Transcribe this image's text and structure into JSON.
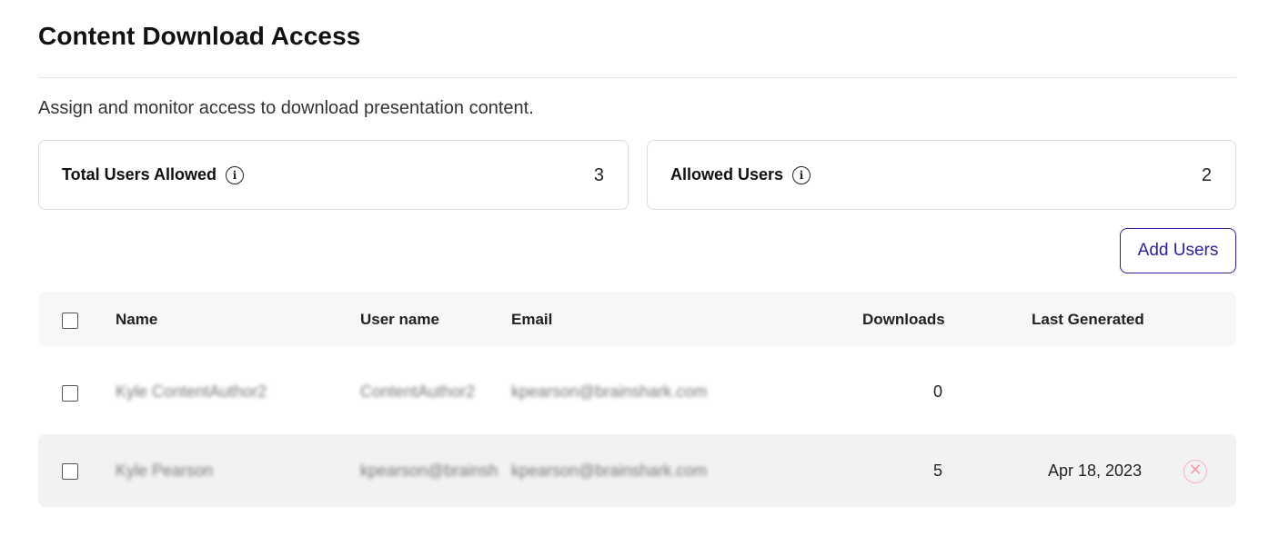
{
  "page": {
    "title": "Content Download Access",
    "description": "Assign and monitor access to download presentation content."
  },
  "stats": {
    "total_users_allowed": {
      "label": "Total Users Allowed",
      "value": "3",
      "icon": "info-icon"
    },
    "allowed_users": {
      "label": "Allowed Users",
      "value": "2",
      "icon": "info-icon"
    }
  },
  "actions": {
    "add_users_label": "Add Users"
  },
  "table": {
    "headers": {
      "name": "Name",
      "username": "User name",
      "email": "Email",
      "downloads": "Downloads",
      "last_generated": "Last Generated"
    },
    "rows": [
      {
        "name": "Kyle ContentAuthor2",
        "username": "ContentAuthor2",
        "email": "kpearson@brainshark.com",
        "downloads": "0",
        "last_generated": ""
      },
      {
        "name": "Kyle Pearson",
        "username": "kpearson@brainsh",
        "email": "kpearson@brainshark.com",
        "downloads": "5",
        "last_generated": "Apr 18, 2023",
        "remove_icon": "close-circle-icon"
      }
    ]
  },
  "colors": {
    "accent": "#2a1f9e",
    "remove": "#f0a0aa"
  }
}
